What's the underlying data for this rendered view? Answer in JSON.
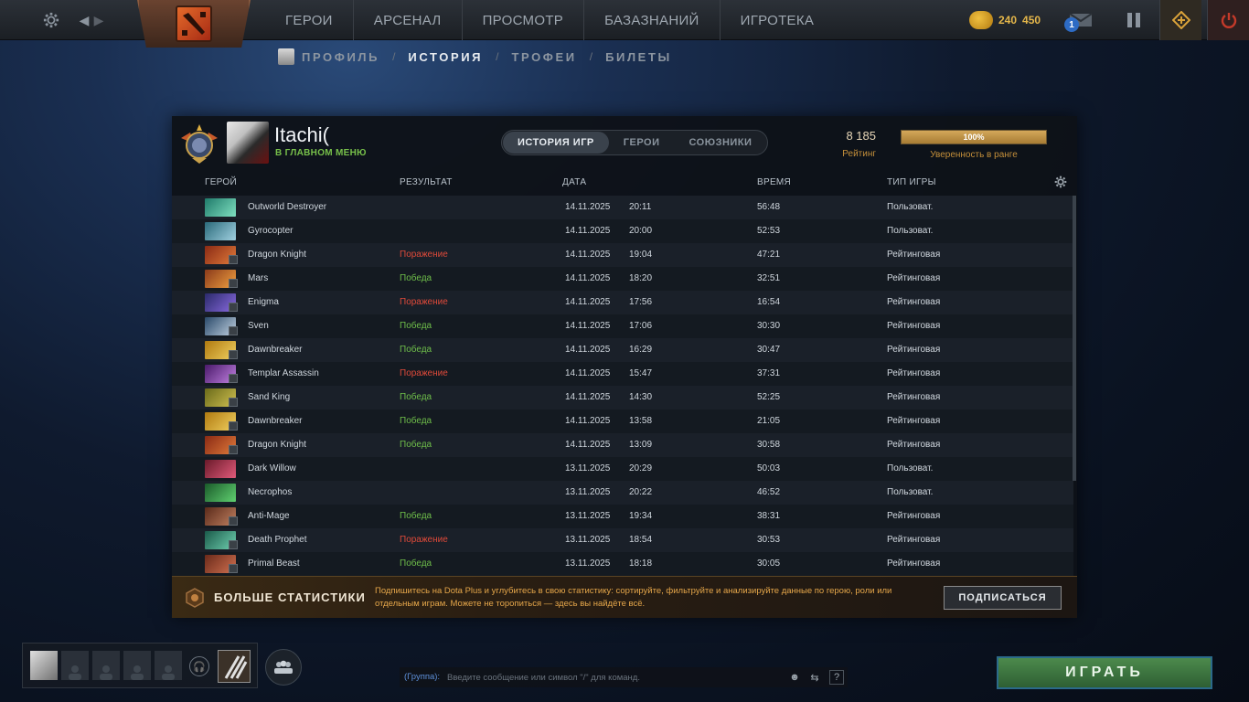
{
  "topbar": {
    "nav": [
      "ГЕРОИ",
      "АРСЕНАЛ",
      "ПРОСМОТР",
      "БАЗАЗНАНИЙ",
      "ИГРОТЕКА"
    ],
    "currency1": "240",
    "currency2": "450",
    "mail_count": "1"
  },
  "subnav": {
    "items": [
      "ПРОФИЛЬ",
      "ИСТОРИЯ",
      "ТРОФЕИ",
      "БИЛЕТЫ"
    ],
    "active": "ИСТОРИЯ"
  },
  "profile": {
    "name": "Itachi(",
    "status": "В ГЛАВНОМ МЕНЮ",
    "tabs": [
      "ИСТОРИЯ ИГР",
      "ГЕРОИ",
      "СОЮЗНИКИ"
    ],
    "active_tab": "ИСТОРИЯ ИГР",
    "rating_value": "8 185",
    "rating_label": "Рейтинг",
    "confidence_value": "100%",
    "confidence_fraction": 1.0,
    "confidence_label": "Уверенность в ранге"
  },
  "table": {
    "headers": {
      "hero": "ГЕРОЙ",
      "result": "РЕЗУЛЬТАТ",
      "date": "ДАТА",
      "duration": "ВРЕМЯ",
      "type": "ТИП ИГРЫ"
    },
    "rows": [
      {
        "hero": "Outworld Destroyer",
        "result": "",
        "date": "14.11.2025",
        "time": "20:11",
        "duration": "56:48",
        "type": "Пользоват.",
        "c1": "#1f7a6a",
        "c2": "#7fe0c0"
      },
      {
        "hero": "Gyrocopter",
        "result": "",
        "date": "14.11.2025",
        "time": "20:00",
        "duration": "52:53",
        "type": "Пользоват.",
        "c1": "#2a6a7a",
        "c2": "#a0d0e0"
      },
      {
        "hero": "Dragon Knight",
        "result": "Поражение",
        "date": "14.11.2025",
        "time": "19:04",
        "duration": "47:21",
        "type": "Рейтинговая",
        "c1": "#8a2a14",
        "c2": "#e07a3a"
      },
      {
        "hero": "Mars",
        "result": "Победа",
        "date": "14.11.2025",
        "time": "18:20",
        "duration": "32:51",
        "type": "Рейтинговая",
        "c1": "#8a3a1a",
        "c2": "#f0a040"
      },
      {
        "hero": "Enigma",
        "result": "Поражение",
        "date": "14.11.2025",
        "time": "17:56",
        "duration": "16:54",
        "type": "Рейтинговая",
        "c1": "#2a2a6a",
        "c2": "#8a6ae0"
      },
      {
        "hero": "Sven",
        "result": "Победа",
        "date": "14.11.2025",
        "time": "17:06",
        "duration": "30:30",
        "type": "Рейтинговая",
        "c1": "#2a4a6a",
        "c2": "#c0d0e0"
      },
      {
        "hero": "Dawnbreaker",
        "result": "Победа",
        "date": "14.11.2025",
        "time": "16:29",
        "duration": "30:47",
        "type": "Рейтинговая",
        "c1": "#b07a10",
        "c2": "#f0d060"
      },
      {
        "hero": "Templar Assassin",
        "result": "Поражение",
        "date": "14.11.2025",
        "time": "15:47",
        "duration": "37:31",
        "type": "Рейтинговая",
        "c1": "#4a1a6a",
        "c2": "#c080e0"
      },
      {
        "hero": "Sand King",
        "result": "Победа",
        "date": "14.11.2025",
        "time": "14:30",
        "duration": "52:25",
        "type": "Рейтинговая",
        "c1": "#6a6a1a",
        "c2": "#d0c050"
      },
      {
        "hero": "Dawnbreaker",
        "result": "Победа",
        "date": "14.11.2025",
        "time": "13:58",
        "duration": "21:05",
        "type": "Рейтинговая",
        "c1": "#b07a10",
        "c2": "#f0d060"
      },
      {
        "hero": "Dragon Knight",
        "result": "Победа",
        "date": "14.11.2025",
        "time": "13:09",
        "duration": "30:58",
        "type": "Рейтинговая",
        "c1": "#8a2a14",
        "c2": "#e07a3a"
      },
      {
        "hero": "Dark Willow",
        "result": "",
        "date": "13.11.2025",
        "time": "20:29",
        "duration": "50:03",
        "type": "Пользоват.",
        "c1": "#6a1a2a",
        "c2": "#e05a7a"
      },
      {
        "hero": "Necrophos",
        "result": "",
        "date": "13.11.2025",
        "time": "20:22",
        "duration": "46:52",
        "type": "Пользоват.",
        "c1": "#1a5a2a",
        "c2": "#60d070"
      },
      {
        "hero": "Anti-Mage",
        "result": "Победа",
        "date": "13.11.2025",
        "time": "19:34",
        "duration": "38:31",
        "type": "Рейтинговая",
        "c1": "#5a2a1a",
        "c2": "#c08060"
      },
      {
        "hero": "Death Prophet",
        "result": "Поражение",
        "date": "13.11.2025",
        "time": "18:54",
        "duration": "30:53",
        "type": "Рейтинговая",
        "c1": "#1a5a4a",
        "c2": "#70d0b0"
      },
      {
        "hero": "Primal Beast",
        "result": "Победа",
        "date": "13.11.2025",
        "time": "18:18",
        "duration": "30:05",
        "type": "Рейтинговая",
        "c1": "#6a2a1a",
        "c2": "#d07050"
      }
    ]
  },
  "promo": {
    "title": "БОЛЬШЕ СТАТИСТИКИ",
    "text": "Подпишитесь на Dota Plus и углубитесь в свою статистику: сортируйте, фильтруйте и анализируйте данные по герою, роли или отдельным играм. Можете не торопиться — здесь вы найдёте всё.",
    "button": "ПОДПИСАТЬСЯ"
  },
  "chat": {
    "channel": "(Группа):",
    "placeholder": "Введите сообщение или символ \"/\" для команд."
  },
  "play_button": "ИГРАТЬ"
}
